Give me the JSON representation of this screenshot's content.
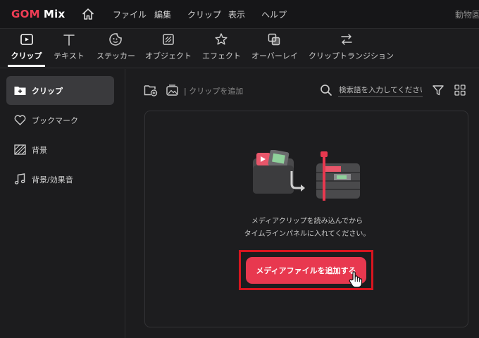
{
  "app": {
    "logo_part1": "GOM",
    "logo_part2": "Mix",
    "accent": "#e8384f"
  },
  "menu": {
    "items": [
      "ファイル",
      "編集",
      "クリップ",
      "表示",
      "ヘルプ"
    ],
    "right_text": "動物園"
  },
  "tabs": [
    {
      "label": "クリップ",
      "icon": "clip-icon",
      "active": true
    },
    {
      "label": "テキスト",
      "icon": "text-icon",
      "active": false
    },
    {
      "label": "ステッカー",
      "icon": "sticker-icon",
      "active": false
    },
    {
      "label": "オブジェクト",
      "icon": "object-icon",
      "active": false
    },
    {
      "label": "エフェクト",
      "icon": "effect-icon",
      "active": false
    },
    {
      "label": "オーバーレイ",
      "icon": "overlay-icon",
      "active": false
    },
    {
      "label": "クリップトランジション",
      "icon": "transition-icon",
      "active": false
    }
  ],
  "sidebar": {
    "items": [
      {
        "label": "クリップ",
        "icon": "add-folder-icon",
        "active": true
      },
      {
        "label": "ブックマーク",
        "icon": "heart-icon",
        "active": false
      },
      {
        "label": "背景",
        "icon": "hatched-square-icon",
        "active": false
      },
      {
        "label": "背景/効果音",
        "icon": "music-note-icon",
        "active": false
      }
    ]
  },
  "toolbar": {
    "add_clip_text": "| クリップを追加",
    "search_placeholder": "検索語を入力してください。"
  },
  "dropzone": {
    "hint_line1": "メディアクリップを読み込んでから",
    "hint_line2": "タイムラインパネルに入れてください。",
    "button_label": "メディアファイルを追加する"
  }
}
